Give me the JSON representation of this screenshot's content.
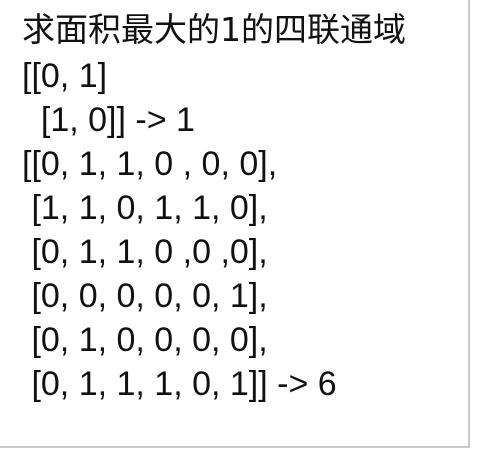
{
  "title": "求面积最大的1的四联通域",
  "lines": [
    "[[0, 1]",
    "  [1, 0]] -> 1",
    "[[0, 1, 1, 0 , 0, 0],",
    " [1, 1, 0, 1, 1, 0],",
    " [0, 1, 1, 0 ,0 ,0],",
    " [0, 0, 0, 0, 0, 1],",
    " [0, 1, 0, 0, 0, 0],",
    " [0, 1, 1, 1, 0, 1]] -> 6"
  ]
}
